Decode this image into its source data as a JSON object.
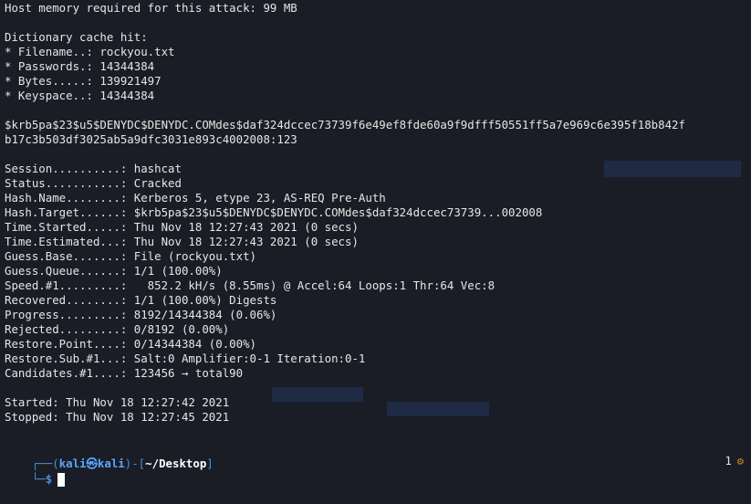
{
  "terminal": {
    "lines": [
      "Host memory required for this attack: 99 MB",
      "",
      "Dictionary cache hit:",
      "* Filename..: rockyou.txt",
      "* Passwords.: 14344384",
      "* Bytes.....: 139921497",
      "* Keyspace..: 14344384",
      "",
      "$krb5pa$23$u5$DENYDC$DENYDC.COMdes$daf324dccec73739f6e49ef8fde60a9f9dfff50551ff5a7e969c6e395f18b842f",
      "b17c3b503df3025ab5a9dfc3031e893c4002008:123",
      "",
      "Session..........: hashcat",
      "Status...........: Cracked",
      "Hash.Name........: Kerberos 5, etype 23, AS-REQ Pre-Auth",
      "Hash.Target......: $krb5pa$23$u5$DENYDC$DENYDC.COMdes$daf324dccec73739...002008",
      "Time.Started.....: Thu Nov 18 12:27:43 2021 (0 secs)",
      "Time.Estimated...: Thu Nov 18 12:27:43 2021 (0 secs)",
      "Guess.Base.......: File (rockyou.txt)",
      "Guess.Queue......: 1/1 (100.00%)",
      "Speed.#1.........:   852.2 kH/s (8.55ms) @ Accel:64 Loops:1 Thr:64 Vec:8",
      "Recovered........: 1/1 (100.00%) Digests",
      "Progress.........: 8192/14344384 (0.06%)",
      "Rejected.........: 0/8192 (0.00%)",
      "Restore.Point....: 0/14344384 (0.00%)",
      "Restore.Sub.#1...: Salt:0 Amplifier:0-1 Iteration:0-1",
      "Candidates.#1....: 123456 → total90",
      "",
      "Started: Thu Nov 18 12:27:42 2021",
      "Stopped: Thu Nov 18 12:27:45 2021"
    ]
  },
  "prompt": {
    "open_bracket": "┌──(",
    "user_host": "kali㉿kali",
    "mid": ")-[",
    "path": "~/Desktop",
    "close_bracket": "]",
    "second_line": "└─$"
  },
  "tray": {
    "count": "1",
    "gear_glyph": "⚙"
  },
  "colors": {
    "background": "#1a1d25",
    "text": "#e6e6e6",
    "prompt_accent": "#4a90d9",
    "user": "#5aa5ff"
  }
}
